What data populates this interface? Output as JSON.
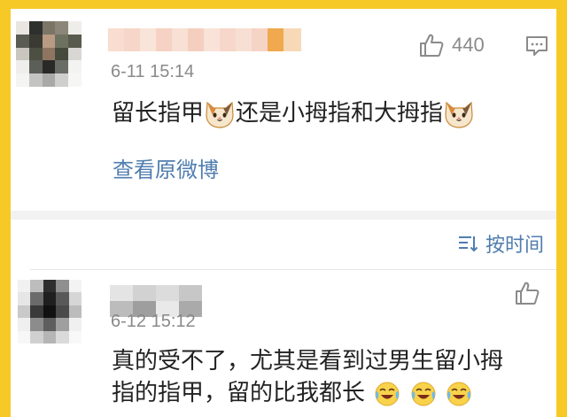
{
  "comments": [
    {
      "timestamp": "6-11 15:14",
      "like_count": "440",
      "text_part1": "留长指甲",
      "text_part2": "还是小拇指和大拇指",
      "view_original": "查看原微博"
    },
    {
      "timestamp": "6-12 15:12",
      "text_line1": "真的受不了，尤其是看到过男生留小拇",
      "text_line2": "指的指甲，留的比我都长"
    }
  ],
  "sort": {
    "label": "按时间"
  },
  "icons": {
    "like": "thumbs-up-icon",
    "reply": "comment-reply-icon",
    "sort": "sort-icon",
    "emoji_cat": "cat-face-emoji",
    "emoji_laugh": "laughing-crying-emoji"
  },
  "colors": {
    "frame": "#f7c927",
    "link": "#507daf",
    "meta": "#8a8a8a",
    "text": "#222222"
  }
}
